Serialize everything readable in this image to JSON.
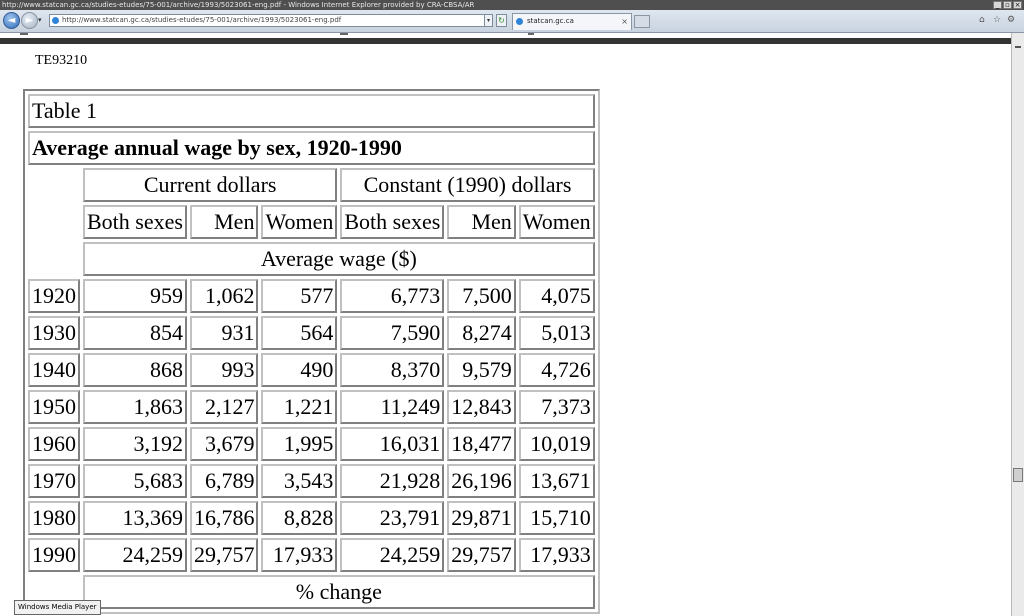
{
  "window": {
    "title": "http://www.statcan.gc.ca/studies-etudes/75-001/archive/1993/5023061-eng.pdf - Windows Internet Explorer provided by CRA-CBSA/AR"
  },
  "navbar": {
    "address": "http://www.statcan.gc.ca/studies-etudes/75-001/archive/1993/5023061-eng.pdf",
    "tab_label": "statcan.gc.ca"
  },
  "document": {
    "id": "TE93210",
    "table": {
      "label": "Table 1",
      "title": "Average annual wage by sex, 1920-1990",
      "group_headers": [
        "Current dollars",
        "Constant (1990) dollars"
      ],
      "sub_headers": [
        "Both sexes",
        "Men",
        "Women",
        "Both sexes",
        "Men",
        "Women"
      ],
      "section_average": "Average wage ($)",
      "rows": [
        {
          "year": "1920",
          "cells": [
            "959",
            "1,062",
            "577",
            "6,773",
            "7,500",
            "4,075"
          ]
        },
        {
          "year": "1930",
          "cells": [
            "854",
            "931",
            "564",
            "7,590",
            "8,274",
            "5,013"
          ]
        },
        {
          "year": "1940",
          "cells": [
            "868",
            "993",
            "490",
            "8,370",
            "9,579",
            "4,726"
          ]
        },
        {
          "year": "1950",
          "cells": [
            "1,863",
            "2,127",
            "1,221",
            "11,249",
            "12,843",
            "7,373"
          ]
        },
        {
          "year": "1960",
          "cells": [
            "3,192",
            "3,679",
            "1,995",
            "16,031",
            "18,477",
            "10,019"
          ]
        },
        {
          "year": "1970",
          "cells": [
            "5,683",
            "6,789",
            "3,543",
            "21,928",
            "26,196",
            "13,671"
          ]
        },
        {
          "year": "1980",
          "cells": [
            "13,369",
            "16,786",
            "8,828",
            "23,791",
            "29,871",
            "15,710"
          ]
        },
        {
          "year": "1990",
          "cells": [
            "24,259",
            "29,757",
            "17,933",
            "24,259",
            "29,757",
            "17,933"
          ]
        }
      ],
      "section_change": "% change"
    }
  },
  "tooltip": "Windows Media Player"
}
